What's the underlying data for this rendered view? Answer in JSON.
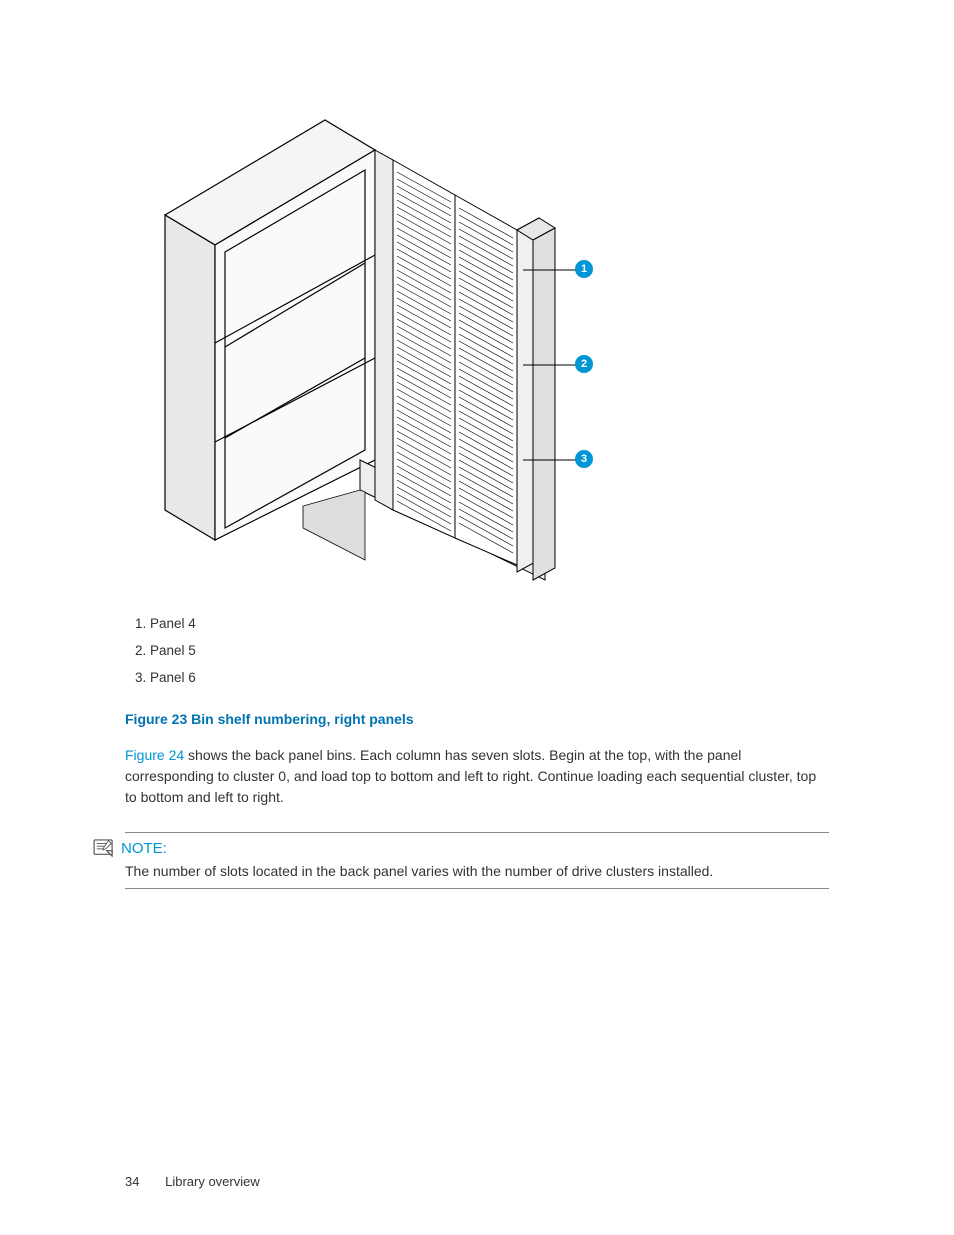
{
  "figure": {
    "callouts": {
      "c1": "1",
      "c2": "2",
      "c3": "3"
    }
  },
  "legend": {
    "item1": "1. Panel 4",
    "item2": "2. Panel 5",
    "item3": "3. Panel 6"
  },
  "caption": "Figure 23 Bin shelf numbering, right panels",
  "body": {
    "xref": "Figure 24",
    "rest": " shows the back panel bins. Each column has seven slots. Begin at the top, with the panel corresponding to cluster 0, and load top to bottom and left to right. Continue loading each sequential cluster, top to bottom and left to right."
  },
  "note": {
    "label": "NOTE:",
    "text": "The number of slots located in the back panel varies with the number of drive clusters installed."
  },
  "footer": {
    "page_number": "34",
    "section": "Library overview"
  }
}
